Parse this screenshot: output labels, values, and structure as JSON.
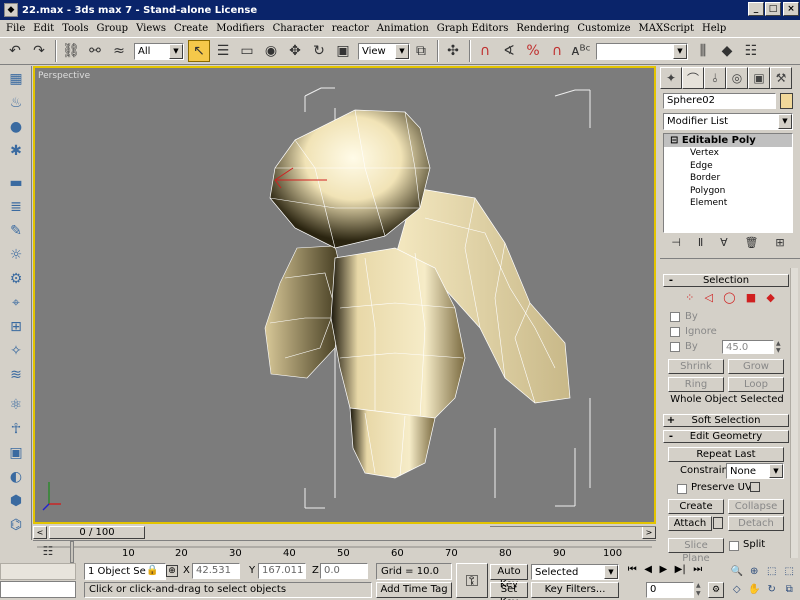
{
  "window": {
    "title": "22.max - 3ds max 7 - Stand-alone License",
    "minimize": "_",
    "maximize": "□",
    "close": "×"
  },
  "menu": [
    "File",
    "Edit",
    "Tools",
    "Group",
    "Views",
    "Create",
    "Modifiers",
    "Character",
    "reactor",
    "Animation",
    "Graph Editors",
    "Rendering",
    "Customize",
    "MAXScript",
    "Help"
  ],
  "toolbar": {
    "selection_filter": "All",
    "coord_system": "View",
    "named_selection": ""
  },
  "viewport": {
    "label": "Perspective"
  },
  "time": {
    "slider": "0 / 100",
    "prev": "<",
    "next": ">",
    "ticks": [
      "10",
      "20",
      "30",
      "40",
      "50",
      "60",
      "70",
      "80",
      "90",
      "100"
    ]
  },
  "command_panel": {
    "object_name": "Sphere02",
    "modifier_list": "Modifier List",
    "stack_head": "Editable Poly",
    "stack_items": [
      "Vertex",
      "Edge",
      "Border",
      "Polygon",
      "Element"
    ],
    "selection": {
      "title": "Selection",
      "by_vertex": "By",
      "ignore": "Ignore",
      "by_angle": "By",
      "angle_value": "45.0",
      "shrink": "Shrink",
      "grow": "Grow",
      "ring": "Ring",
      "loop": "Loop",
      "status": "Whole Object Selected"
    },
    "soft_selection": "Soft Selection",
    "edit_geometry": {
      "title": "Edit Geometry",
      "repeat_last": "Repeat Last",
      "constraints_label": "Constraints:",
      "constraints_value": "None",
      "preserve_uvs": "Preserve UVs",
      "create": "Create",
      "collapse": "Collapse",
      "attach": "Attach",
      "detach": "Detach",
      "slice_plane": "Slice Plane",
      "split": "Split"
    }
  },
  "status": {
    "selection_count": "1 Object Se",
    "x_label": "X",
    "x_value": "42.531",
    "y_label": "Y",
    "y_value": "167.011",
    "z_label": "Z",
    "z_value": "0.0",
    "grid": "Grid = 10.0",
    "prompt": "Click or click-and-drag to select objects",
    "add_time_tag": "Add Time Tag",
    "auto_key": "Auto Key",
    "set_key": "Set Key",
    "key_mode": "Selected",
    "key_filters": "Key Filters...",
    "frame": "0"
  },
  "colors": {
    "titlebar": "#0a246a",
    "viewport_bg": "#7c7c7c",
    "active_border": "#e3c400",
    "mesh": "#f1e3b6"
  }
}
